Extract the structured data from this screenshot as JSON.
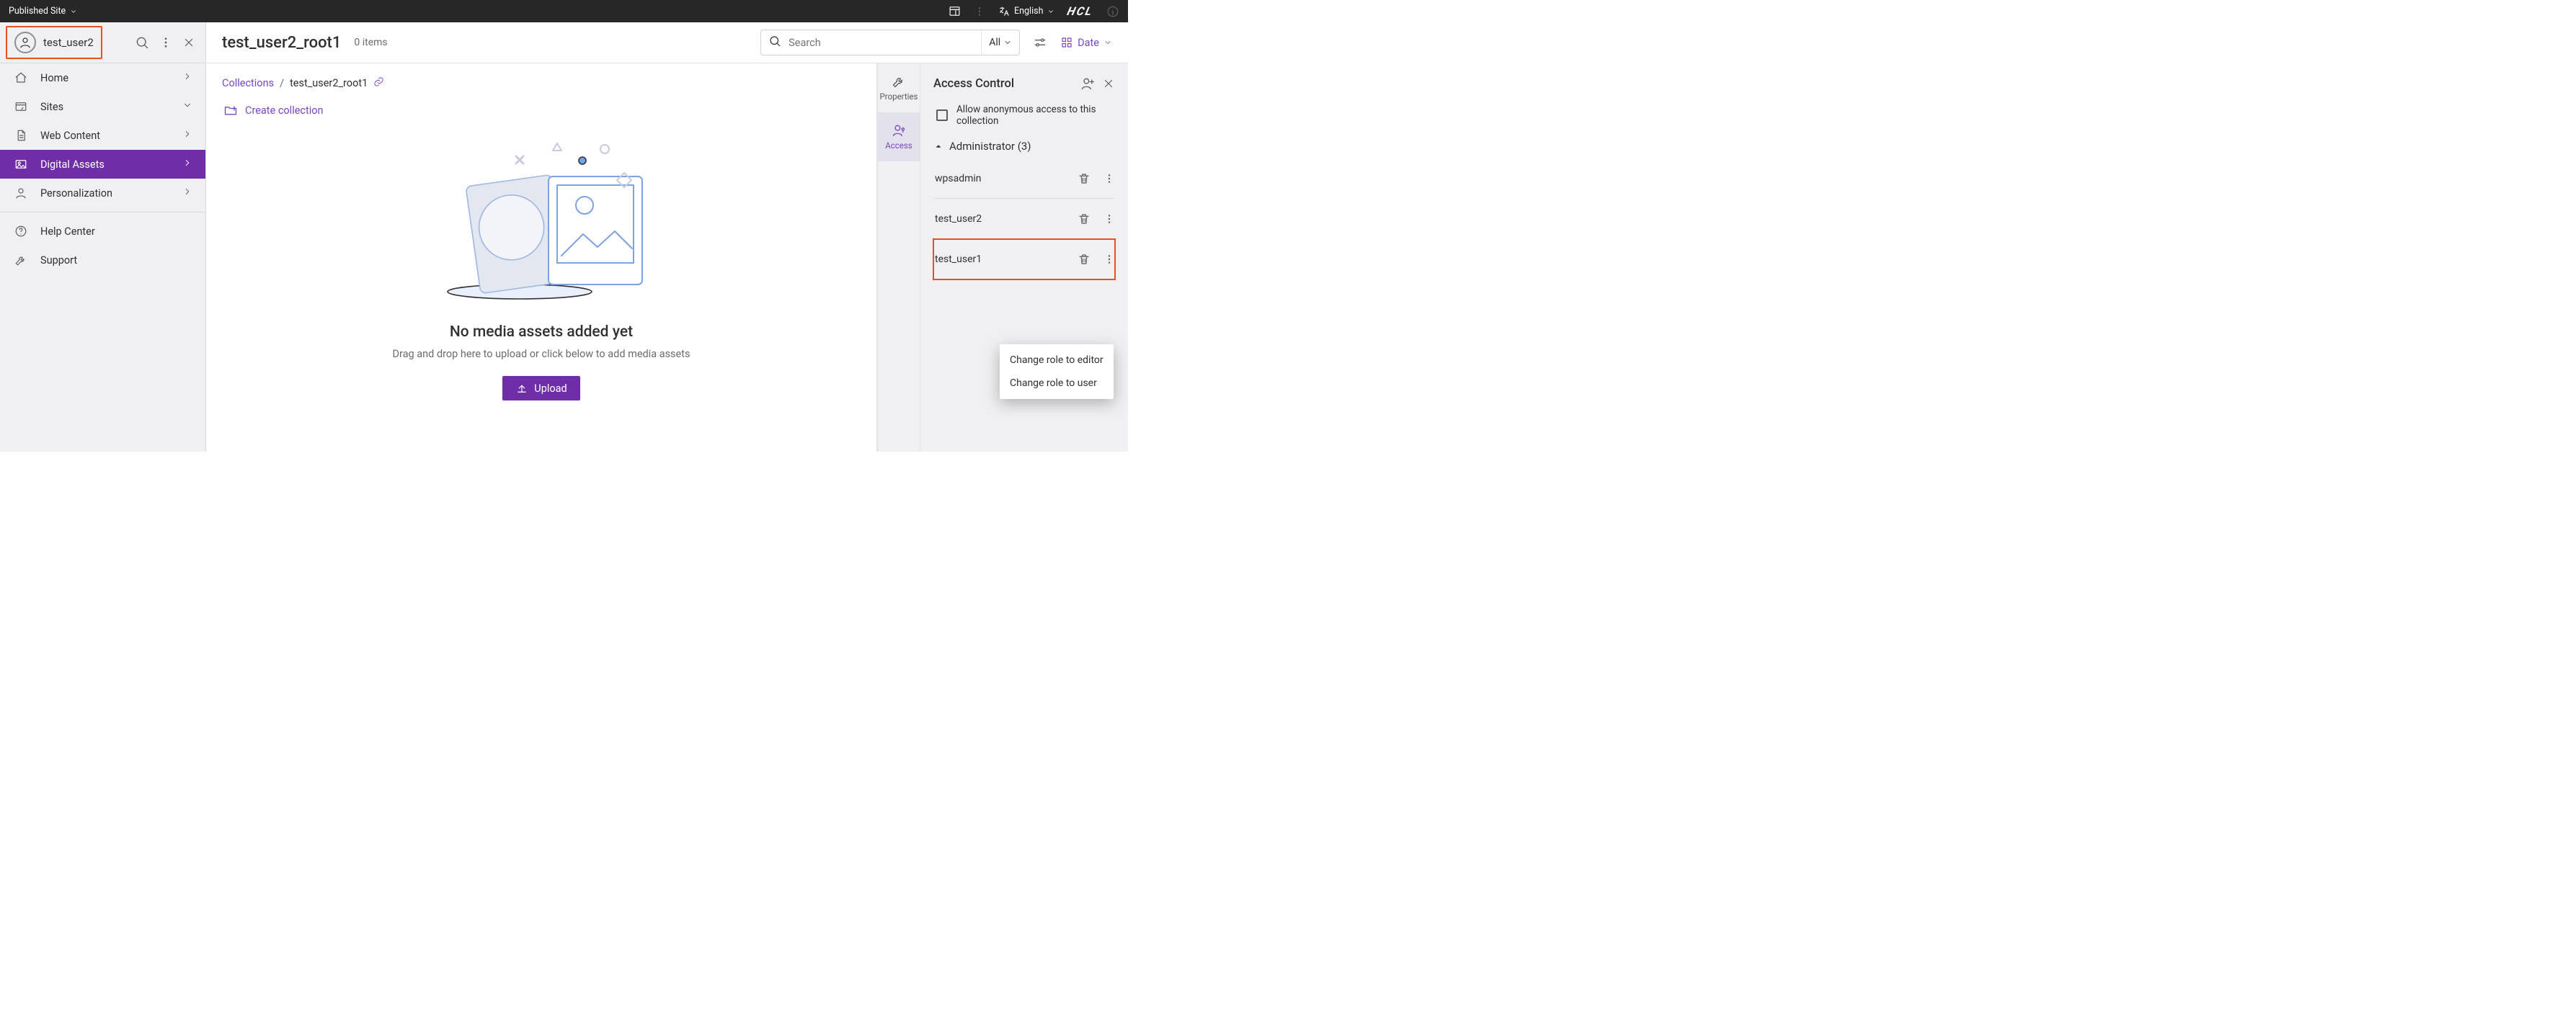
{
  "topbar": {
    "site_mode": "Published Site",
    "language": "English",
    "brand": "HCL"
  },
  "sidebar": {
    "username": "test_user2",
    "nav": [
      {
        "label": "Home"
      },
      {
        "label": "Sites"
      },
      {
        "label": "Web Content"
      },
      {
        "label": "Digital Assets"
      },
      {
        "label": "Personalization"
      }
    ],
    "help": "Help Center",
    "support": "Support"
  },
  "header": {
    "title": "test_user2_root1",
    "subtitle": "0 items",
    "search_placeholder": "Search",
    "filter_all": "All",
    "sort_label": "Date"
  },
  "breadcrumb": {
    "root": "Collections",
    "current": "test_user2_root1"
  },
  "create_collection_label": "Create collection",
  "empty_state": {
    "title": "No media assets added yet",
    "subtitle": "Drag and drop here to upload or click below to add media assets",
    "upload_label": "Upload"
  },
  "rail": {
    "properties": "Properties",
    "access": "Access"
  },
  "access_panel": {
    "title": "Access Control",
    "anonymous_label": "Allow anonymous access to this collection",
    "role_label": "Administrator (3)",
    "users": [
      {
        "name": "wpsadmin"
      },
      {
        "name": "test_user2"
      },
      {
        "name": "test_user1"
      }
    ],
    "menu": {
      "to_editor": "Change role to editor",
      "to_user": "Change role to user"
    }
  }
}
